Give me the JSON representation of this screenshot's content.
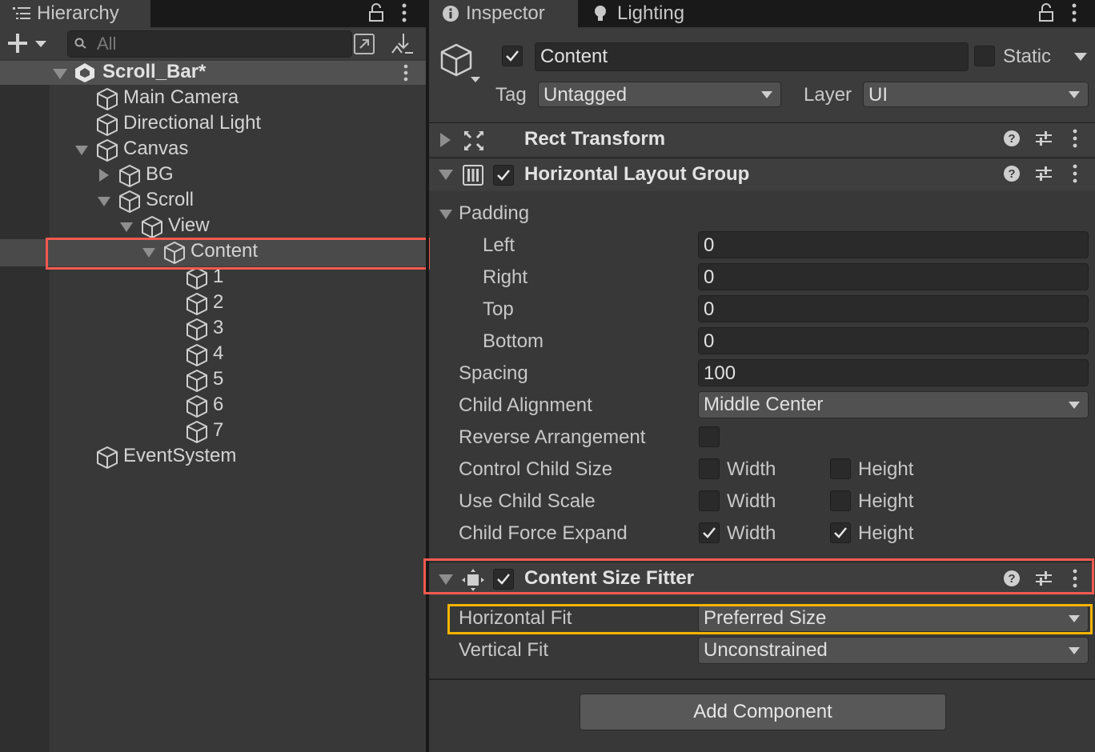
{
  "hierarchy": {
    "tab_label": "Hierarchy",
    "search_placeholder": "All",
    "scene": "Scroll_Bar*",
    "items": [
      {
        "label": "Main Camera"
      },
      {
        "label": "Directional Light"
      },
      {
        "label": "Canvas"
      },
      {
        "label": "BG"
      },
      {
        "label": "Scroll"
      },
      {
        "label": "View"
      },
      {
        "label": "Content"
      },
      {
        "label": "1"
      },
      {
        "label": "2"
      },
      {
        "label": "3"
      },
      {
        "label": "4"
      },
      {
        "label": "5"
      },
      {
        "label": "6"
      },
      {
        "label": "7"
      },
      {
        "label": "EventSystem"
      }
    ]
  },
  "inspector": {
    "tab_inspector": "Inspector",
    "tab_lighting": "Lighting",
    "object_name": "Content",
    "static_label": "Static",
    "tag_label": "Tag",
    "tag_value": "Untagged",
    "layer_label": "Layer",
    "layer_value": "UI",
    "components": {
      "rect_transform": "Rect Transform",
      "horizontal_layout_group": "Horizontal Layout Group",
      "content_size_fitter": "Content Size Fitter"
    },
    "hlg": {
      "padding_label": "Padding",
      "left_label": "Left",
      "left_value": "0",
      "right_label": "Right",
      "right_value": "0",
      "top_label": "Top",
      "top_value": "0",
      "bottom_label": "Bottom",
      "bottom_value": "0",
      "spacing_label": "Spacing",
      "spacing_value": "100",
      "child_alignment_label": "Child Alignment",
      "child_alignment_value": "Middle Center",
      "reverse_label": "Reverse Arrangement",
      "control_child_size_label": "Control Child Size",
      "use_child_scale_label": "Use Child Scale",
      "child_force_expand_label": "Child Force Expand",
      "width_label": "Width",
      "height_label": "Height"
    },
    "csf": {
      "horizontal_fit_label": "Horizontal Fit",
      "horizontal_fit_value": "Preferred Size",
      "vertical_fit_label": "Vertical Fit",
      "vertical_fit_value": "Unconstrained"
    },
    "add_component": "Add Component"
  },
  "colors": {
    "highlight_red": "#f25a4f",
    "highlight_yellow": "#f5b400",
    "panel_bg": "#383838"
  }
}
